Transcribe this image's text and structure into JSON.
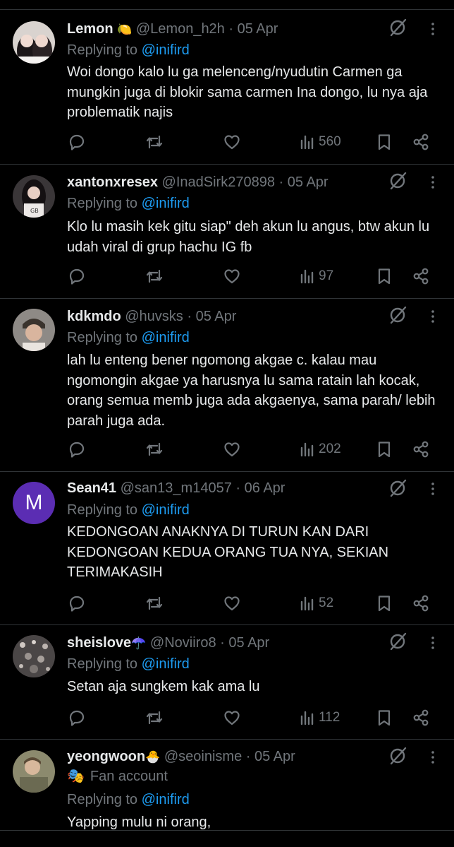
{
  "replies": [
    {
      "name": "Lemon",
      "badge": "🍋",
      "handle": "@Lemon_h2h",
      "dot": "·",
      "date": "05 Apr",
      "replying_label": "Replying to",
      "replying_handle": "@inifird",
      "text": "Woi dongo kalo lu ga melenceng/nyudutin Carmen ga mungkin juga di blokir sama carmen Ina dongo, lu nya aja problematik najis",
      "views": "560",
      "avatar_icon": "profile-photo"
    },
    {
      "name": "xantonxresex",
      "badge": "",
      "handle": "@InadSirk270898",
      "dot": "·",
      "date": "05 Apr",
      "replying_label": "Replying to",
      "replying_handle": "@inifird",
      "text": "Klo lu masih kek gitu siap\" deh akun lu angus, btw akun lu udah viral di grup hachu IG fb",
      "views": "97",
      "avatar_icon": "profile-photo"
    },
    {
      "name": "kdkmdo",
      "badge": "",
      "handle": "@huvsks",
      "dot": "·",
      "date": "05 Apr",
      "replying_label": "Replying to",
      "replying_handle": "@inifird",
      "text": "lah lu enteng bener ngomong akgae c. kalau mau ngomongin akgae ya harusnya lu sama ratain lah kocak, orang semua memb juga ada akgaenya, sama parah/ lebih parah juga ada.",
      "views": "202",
      "avatar_icon": "profile-photo"
    },
    {
      "name": "Sean41",
      "badge": "",
      "handle": "@san13_m14057",
      "dot": "·",
      "date": "06 Apr",
      "replying_label": "Replying to",
      "replying_handle": "@inifird",
      "text": "KEDONGOAN ANAKNYA DI TURUN KAN DARI KEDONGOAN KEDUA ORANG TUA NYA, SEKIAN TERIMAKASIH",
      "views": "52",
      "avatar_letter": "M"
    },
    {
      "name": "sheislove",
      "badge": "☂️",
      "handle": "@Noviiro8",
      "dot": "·",
      "date": "05 Apr",
      "replying_label": "Replying to",
      "replying_handle": "@inifird",
      "text": "Setan aja sungkem kak ama lu",
      "views": "112",
      "avatar_icon": "profile-photo"
    },
    {
      "name": "yeongwoon",
      "badge": "🐣",
      "handle": "@seoinisme",
      "dot": "·",
      "date": "05 Apr",
      "fan_icon": "🎭",
      "fan_label": "Fan account",
      "replying_label": "Replying to",
      "replying_handle": "@inifird",
      "text": "Yapping mulu ni orang,",
      "avatar_icon": "profile-photo"
    }
  ],
  "colors": {
    "background": "#000000",
    "text": "#e7e9ea",
    "secondary": "#71767b",
    "link": "#1d9bf0",
    "divider": "#2f3336",
    "sean_avatar": "#5b2db3"
  },
  "icons": [
    "grok-icon",
    "more-icon",
    "reply-icon",
    "retweet-icon",
    "like-icon",
    "views-icon",
    "bookmark-icon",
    "share-icon"
  ]
}
